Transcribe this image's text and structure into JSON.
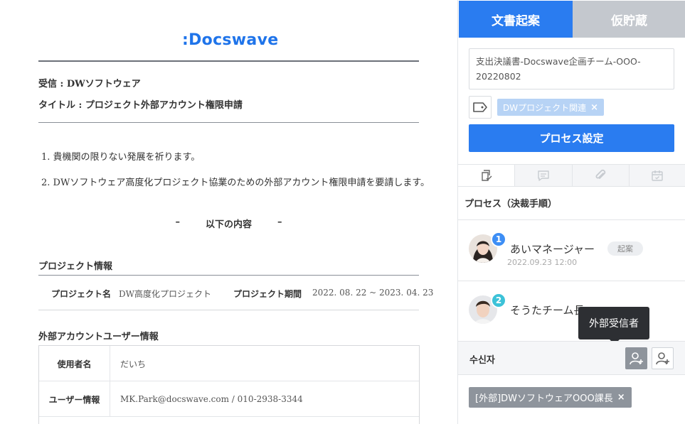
{
  "document": {
    "logo": ":Docswave",
    "recipient_label": "受信 : DWソフトウェア",
    "title_label": "タイトル : プロジェクト外部アカウント権限申請",
    "items": [
      "1. 貴機関の限りない発展を祈ります。",
      "2. DWソフトウェア高度化プロジェクト協業のための外部アカウント権限申請を要請します。"
    ],
    "center_note": {
      "dash_left": "–",
      "text": "以下の内容",
      "dash_right": "–"
    },
    "project_section_title": "プロジェクト情報",
    "project_name_label": "プロジェクト名",
    "project_name_value": "DW高度化プロジェクト",
    "project_period_label": "プロジェクト期間",
    "project_period_value": "2022. 08. 22 ~ 2023. 04. 23",
    "user_section_title": "外部アカウントユーザー情報",
    "user_table": [
      {
        "label": "使用者名",
        "value": "だいち"
      },
      {
        "label": "ユーザー情報",
        "value": "MK.Park@docswave.com  /  010-2938-3344"
      }
    ]
  },
  "panel": {
    "tab_draft": "文書起案",
    "tab_temp_save": "仮貯蔵",
    "doc_name": "支出決議書-Docswave企画チーム-OOO-20220802",
    "tag_chip": "DWプロジェクト関連",
    "tag_close": "×",
    "process_button": "プロセス設定",
    "sub_tabs": [
      "approval-icon",
      "comment-icon",
      "attachment-icon",
      "calendar-icon"
    ],
    "process_title": "プロセス（決裁手順）",
    "approvers": [
      {
        "step": "1",
        "name": "あいマネージャー",
        "role": "起案",
        "date": "2022.09.23 12:00",
        "badge_color": "#3d8ef5"
      },
      {
        "step": "2",
        "name": "そうたチーム長",
        "badge_color": "#3cc2d8"
      }
    ],
    "tooltip": "外部受信者",
    "receiver_label": "수신자",
    "receiver_chip": "[外部]DWソフトウェアOOO課長",
    "receiver_close": "×"
  },
  "colors": {
    "accent": "#2a7cf0",
    "inactive_tab": "#c4c8ce",
    "tag_chip": "#b7d3f5",
    "receiver_chip": "#8e949c"
  }
}
